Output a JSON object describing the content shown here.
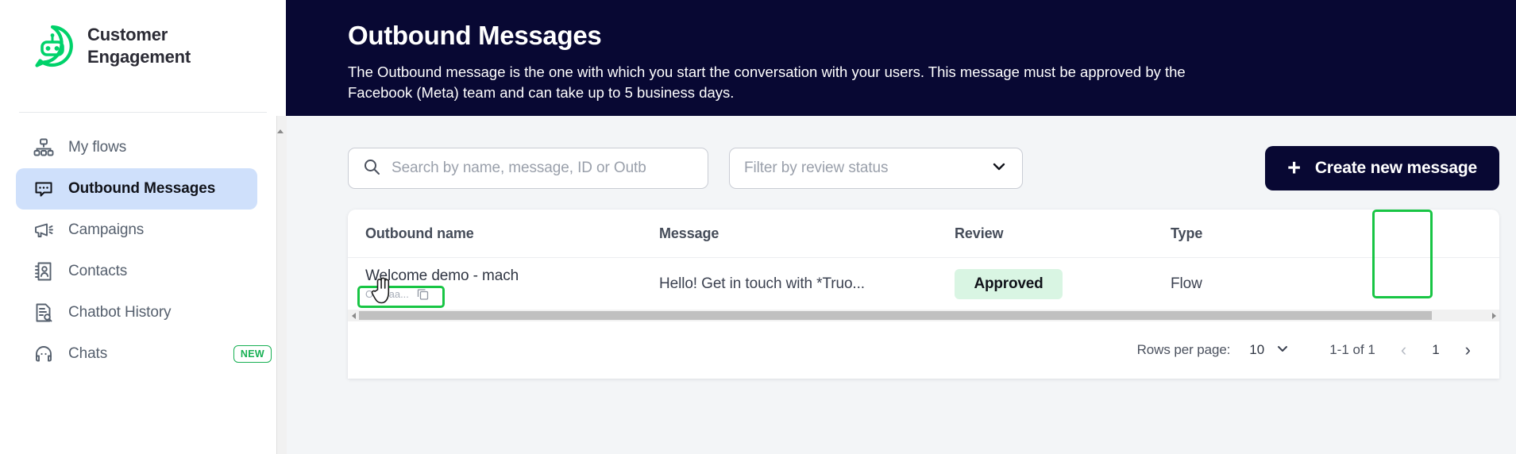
{
  "sidebar": {
    "brand": {
      "name": "Customer Engagement",
      "logo_icon": "chatbot-logo-icon"
    },
    "items": [
      {
        "label": "My flows",
        "icon": "flow-tree-icon",
        "active": false,
        "badge": ""
      },
      {
        "label": "Outbound Messages",
        "icon": "chat-bubble-dots-icon",
        "active": true,
        "badge": ""
      },
      {
        "label": "Campaigns",
        "icon": "megaphone-icon",
        "active": false,
        "badge": ""
      },
      {
        "label": "Contacts",
        "icon": "contact-book-icon",
        "active": false,
        "badge": ""
      },
      {
        "label": "Chatbot History",
        "icon": "document-search-icon",
        "active": false,
        "badge": ""
      },
      {
        "label": "Chats",
        "icon": "headset-support-icon",
        "active": false,
        "badge": "NEW"
      }
    ]
  },
  "hero": {
    "title": "Outbound Messages",
    "description": "The Outbound message is the one with which you start the conversation with your users. This message must be approved by the Facebook (Meta) team and can take up to 5 business days."
  },
  "toolbar": {
    "search_placeholder": "Search by name, message, ID or Outb",
    "search_value": "",
    "search_icon": "search-icon",
    "filter_placeholder": "Filter by review status",
    "filter_value": "",
    "filter_icon": "chevron-down-icon",
    "create_label": "Create new message",
    "create_icon": "plus-icon"
  },
  "table": {
    "columns": [
      "Outbound name",
      "Message",
      "Review",
      "Type"
    ],
    "rows": [
      {
        "name": "Welcome demo - mach",
        "id_chip": "OTBlaa...",
        "copy_icon": "copy-icon",
        "message": "Hello! Get in touch with *Truo...",
        "review": "Approved",
        "type": "Flow"
      }
    ]
  },
  "pagination": {
    "rows_per_page_label": "Rows per page:",
    "rows_per_page_value": "10",
    "dropdown_icon": "chevron-down-icon",
    "range": "1-1 of 1",
    "prev_icon": "chevron-left-icon",
    "page_number": "1",
    "next_icon": "chevron-right-icon"
  },
  "colors": {
    "brand_green": "#00d26a",
    "header_navy": "#080833",
    "active_nav": "#cfe0fb",
    "approved_bg": "#d9f5e3",
    "annotation_green": "#18c544",
    "badge_new_green": "#17b053"
  }
}
